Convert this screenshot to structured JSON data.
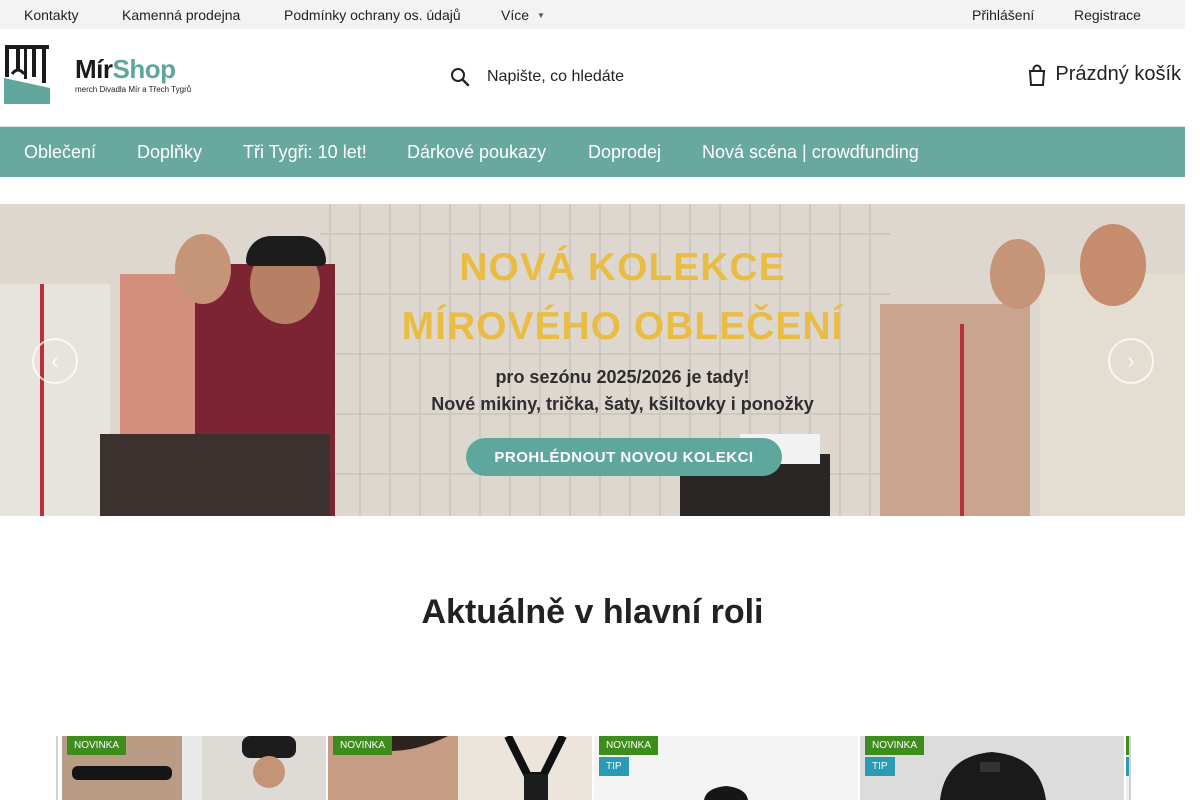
{
  "topbar": {
    "links": [
      "Kontakty",
      "Kamenná prodejna",
      "Podmínky ochrany os. údajů",
      "Více"
    ],
    "account": [
      "Přihlášení",
      "Registrace"
    ]
  },
  "header": {
    "logo_name": "Mír",
    "logo_name_accent": "Shop",
    "logo_tagline": "merch Divadla Mír a Třech Tygrů",
    "search_label": "Napište, co hledáte",
    "cart_label": "Prázdný košík"
  },
  "nav": {
    "items": [
      "Oblečení",
      "Doplňky",
      "Tři Tygři: 10 let!",
      "Dárkové poukazy",
      "Doprodej",
      "Nová scéna | crowdfunding"
    ]
  },
  "banner": {
    "headline_1": "NOVÁ KOLEKCE",
    "headline_2": "MÍROVÉHO OBLEČENÍ",
    "sub_1": "pro sezónu 2025/2026 je tady!",
    "sub_2": "Nové mikiny, trička, šaty, kšiltovky i ponožky",
    "cta": "PROHLÉDNOUT NOVOU KOLEKCI",
    "prev": "‹",
    "next": "›"
  },
  "section": {
    "title": "Aktuálně v hlavní roli"
  },
  "products": [
    {
      "badges": [
        "NOVINKA"
      ]
    },
    {
      "badges": [
        "NOVINKA"
      ]
    },
    {
      "badges": [
        "NOVINKA",
        "TIP"
      ]
    },
    {
      "badges": [
        "NOVINKA",
        "TIP"
      ]
    }
  ],
  "colors": {
    "accent": "#68a89f",
    "banner_headline": "#e9bd44",
    "badge_new": "#3f8c1e",
    "badge_tip": "#2b9ab5"
  },
  "icons": {
    "search": "search-icon",
    "cart": "cart-icon",
    "dropdown": "chevron-down-icon"
  }
}
